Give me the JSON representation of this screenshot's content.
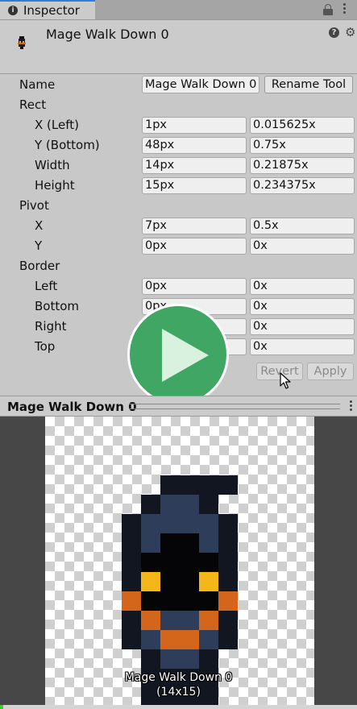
{
  "tab": {
    "label": "Inspector"
  },
  "header": {
    "title": "Mage Walk Down 0"
  },
  "name_row": {
    "label": "Name",
    "value": "Mage Walk Down 0",
    "rename_button": "Rename Tool"
  },
  "rect": {
    "label": "Rect",
    "rows": [
      {
        "label": "X (Left)",
        "px": "1px",
        "norm": "0.015625x"
      },
      {
        "label": "Y (Bottom)",
        "px": "48px",
        "norm": "0.75x"
      },
      {
        "label": "Width",
        "px": "14px",
        "norm": "0.21875x"
      },
      {
        "label": "Height",
        "px": "15px",
        "norm": "0.234375x"
      }
    ]
  },
  "pivot": {
    "label": "Pivot",
    "rows": [
      {
        "label": "X",
        "px": "7px",
        "norm": "0.5x"
      },
      {
        "label": "Y",
        "px": "0px",
        "norm": "0x"
      }
    ]
  },
  "border": {
    "label": "Border",
    "rows": [
      {
        "label": "Left",
        "px": "0px",
        "norm": "0x"
      },
      {
        "label": "Bottom",
        "px": "0px",
        "norm": "0x"
      },
      {
        "label": "Right",
        "px": "0px",
        "norm": "0x"
      },
      {
        "label": "Top",
        "px": "0px",
        "norm": "0x"
      }
    ]
  },
  "actions": {
    "revert": "Revert",
    "apply": "Apply"
  },
  "preview": {
    "title": "Mage Walk Down 0",
    "caption_name": "Mage Walk Down 0",
    "caption_size": "(14x15)"
  },
  "colors": {
    "accent": "#3a79d7",
    "play": "#3fa663",
    "sprite_orange": "#d4661c",
    "sprite_yellow": "#f4b619",
    "sprite_blue": "#2e3d59"
  },
  "icons": [
    "info-icon",
    "lock-icon",
    "kebab-menu-icon",
    "help-icon",
    "gear-icon",
    "play-icon",
    "cursor-icon"
  ]
}
